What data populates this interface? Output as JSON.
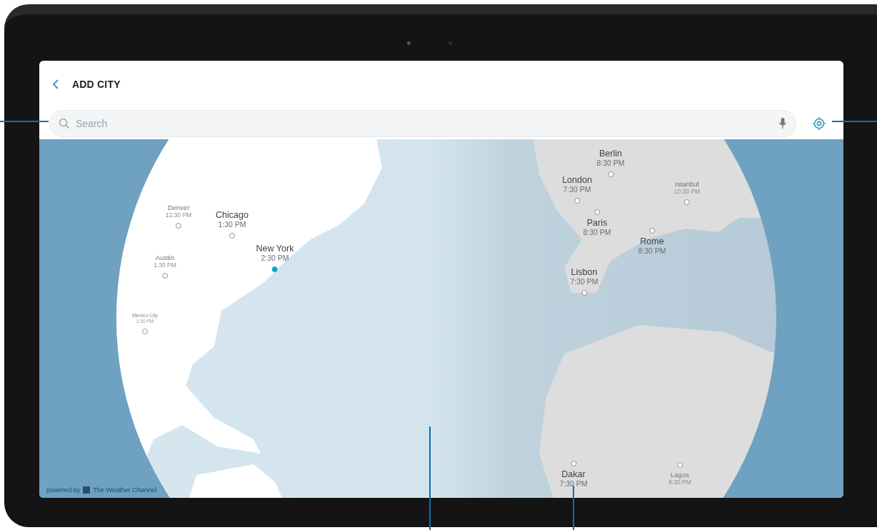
{
  "header": {
    "title": "ADD CITY"
  },
  "search": {
    "placeholder": "Search"
  },
  "cities": [
    {
      "name": "Denver",
      "time": "12:30 PM",
      "kind": "minor",
      "selected": false
    },
    {
      "name": "Chicago",
      "time": "1:30 PM",
      "kind": "major",
      "selected": false
    },
    {
      "name": "New York",
      "time": "2:30 PM",
      "kind": "major",
      "selected": true
    },
    {
      "name": "Austin",
      "time": "1:30 PM",
      "kind": "minor",
      "selected": false
    },
    {
      "name": "Mexico City",
      "time": "1:30 PM",
      "kind": "tiny",
      "selected": false
    },
    {
      "name": "Berlin",
      "time": "8:30 PM",
      "kind": "major",
      "selected": false
    },
    {
      "name": "London",
      "time": "7:30 PM",
      "kind": "major",
      "selected": false
    },
    {
      "name": "Istanbul",
      "time": "10:30 PM",
      "kind": "minor",
      "selected": false
    },
    {
      "name": "Paris",
      "time": "8:30 PM",
      "kind": "major",
      "selected": false
    },
    {
      "name": "Rome",
      "time": "8:30 PM",
      "kind": "major",
      "selected": false
    },
    {
      "name": "Lisbon",
      "time": "7:30 PM",
      "kind": "major",
      "selected": false
    },
    {
      "name": "Dakar",
      "time": "7:30 PM",
      "kind": "major",
      "selected": false
    },
    {
      "name": "Lagos",
      "time": "8:30 PM",
      "kind": "minor",
      "selected": false
    }
  ],
  "attribution": {
    "prefix": "powered by",
    "brand": "The Weather Channel"
  }
}
